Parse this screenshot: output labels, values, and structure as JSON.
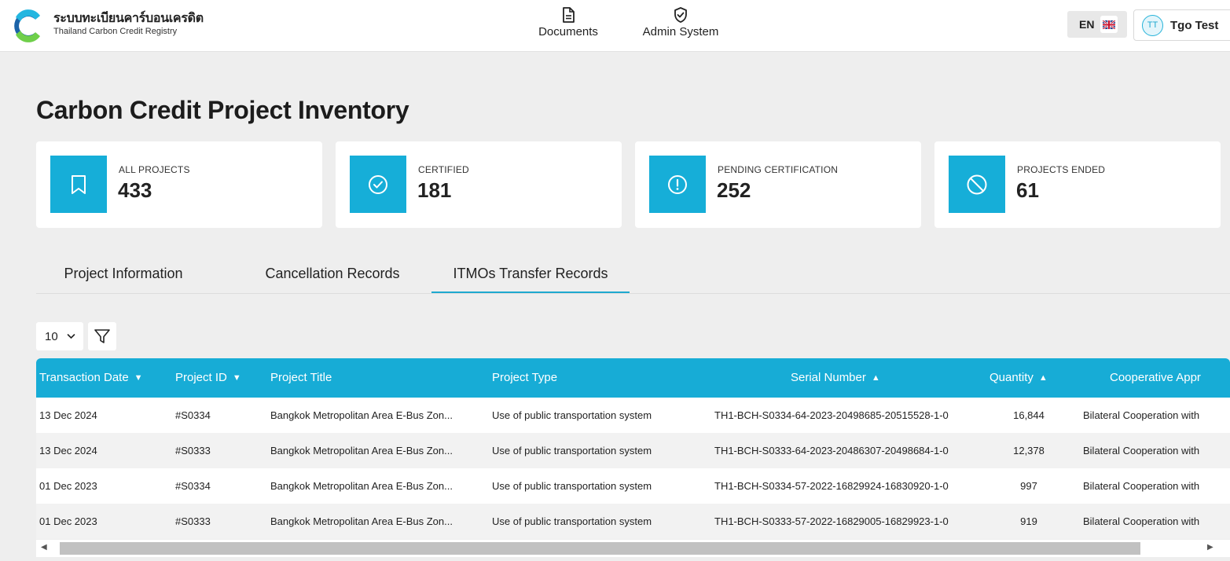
{
  "header": {
    "brand_th": "ระบบทะเบียนคาร์บอนเครดิต",
    "brand_en": "Thailand Carbon Credit Registry",
    "nav": [
      {
        "label": "Documents",
        "icon": "document-icon"
      },
      {
        "label": "Admin System",
        "icon": "shield-check-icon"
      }
    ],
    "language": "EN",
    "user": {
      "initials": "TT",
      "name": "Tgo Test"
    }
  },
  "page": {
    "title": "Carbon Credit Project Inventory"
  },
  "stats": [
    {
      "label": "ALL PROJECTS",
      "value": "433",
      "icon": "bookmark-icon"
    },
    {
      "label": "CERTIFIED",
      "value": "181",
      "icon": "check-circle-icon"
    },
    {
      "label": "PENDING CERTIFICATION",
      "value": "252",
      "icon": "exclamation-circle-icon"
    },
    {
      "label": "PROJECTS ENDED",
      "value": "61",
      "icon": "ban-icon"
    }
  ],
  "tabs": [
    {
      "label": "Project Information",
      "active": false
    },
    {
      "label": "Cancellation Records",
      "active": false
    },
    {
      "label": "ITMOs Transfer Records",
      "active": true
    }
  ],
  "controls": {
    "page_size": "10"
  },
  "table": {
    "columns": [
      "Transaction Date",
      "Project ID",
      "Project Title",
      "Project Type",
      "Serial Number",
      "Quantity",
      "Cooperative Appr"
    ],
    "rows": [
      [
        "13 Dec 2024",
        "#S0334",
        "Bangkok Metropolitan Area E-Bus Zon...",
        "Use of public transportation system",
        "TH1-BCH-S0334-64-2023-20498685-20515528-1-0",
        "16,844",
        "Bilateral Cooperation with"
      ],
      [
        "13 Dec 2024",
        "#S0333",
        "Bangkok Metropolitan Area E-Bus Zon...",
        "Use of public transportation system",
        "TH1-BCH-S0333-64-2023-20486307-20498684-1-0",
        "12,378",
        "Bilateral Cooperation with"
      ],
      [
        "01 Dec 2023",
        "#S0334",
        "Bangkok Metropolitan Area E-Bus Zon...",
        "Use of public transportation system",
        "TH1-BCH-S0334-57-2022-16829924-16830920-1-0",
        "997",
        "Bilateral Cooperation with"
      ],
      [
        "01 Dec 2023",
        "#S0333",
        "Bangkok Metropolitan Area E-Bus Zon...",
        "Use of public transportation system",
        "TH1-BCH-S0333-57-2022-16829005-16829923-1-0",
        "919",
        "Bilateral Cooperation with"
      ]
    ]
  },
  "colors": {
    "accent": "#17acd6",
    "background": "#eeeeee",
    "surface": "#ffffff"
  }
}
